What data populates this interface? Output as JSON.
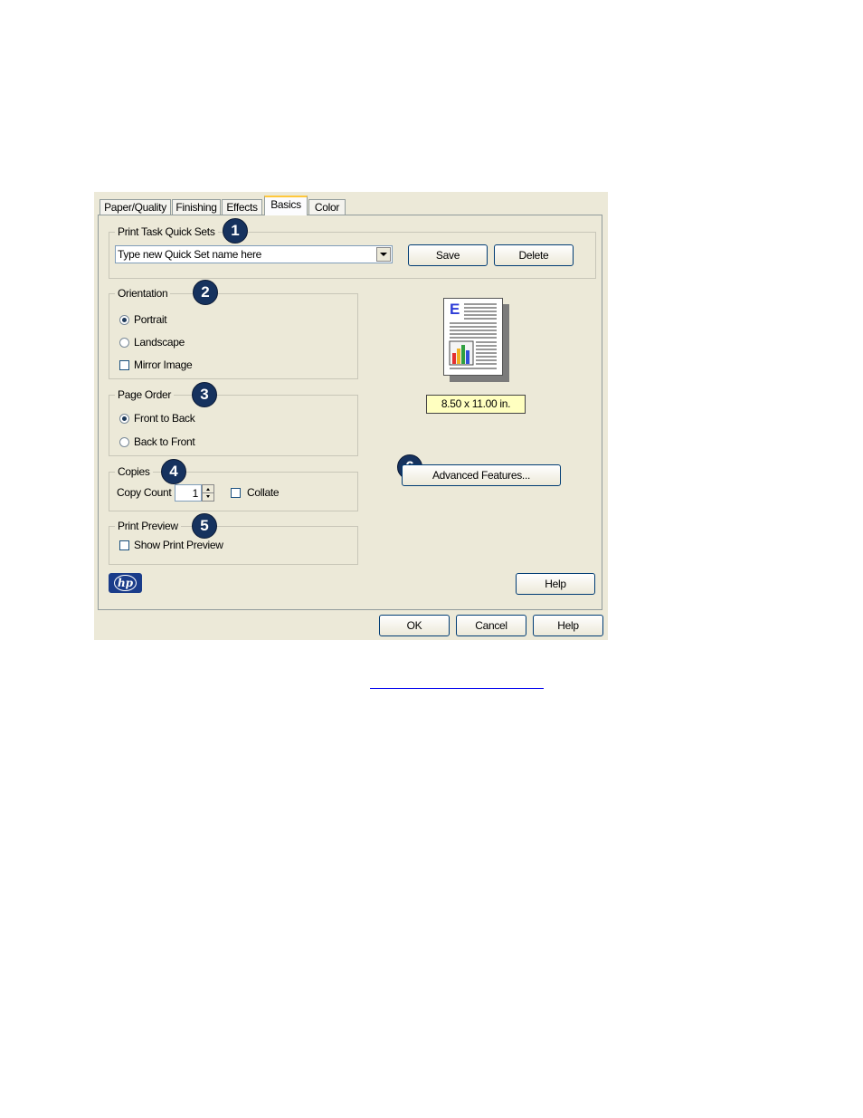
{
  "tabs": [
    "Paper/Quality",
    "Finishing",
    "Effects",
    "Basics",
    "Color"
  ],
  "active_tab": "Basics",
  "quick_sets": {
    "legend": "Print Task Quick Sets",
    "badge": "1",
    "value": "Type new Quick Set name here",
    "save": "Save",
    "delete": "Delete"
  },
  "orientation": {
    "legend": "Orientation",
    "badge": "2",
    "portrait": "Portrait",
    "landscape": "Landscape",
    "mirror": "Mirror Image",
    "selected": "Portrait",
    "mirror_checked": false
  },
  "page_order": {
    "legend": "Page Order",
    "badge": "3",
    "front_to_back": "Front to Back",
    "back_to_front": "Back to Front",
    "selected": "Front to Back"
  },
  "copies": {
    "legend": "Copies",
    "badge": "4",
    "count_label": "Copy Count",
    "count": "1",
    "collate": "Collate",
    "collate_checked": false
  },
  "print_preview": {
    "legend": "Print Preview",
    "badge": "5",
    "show": "Show Print Preview",
    "show_checked": false
  },
  "preview": {
    "paper_size": "8.50 x 11.00 in.",
    "page_letter": "E"
  },
  "advanced": {
    "badge": "6",
    "label": "Advanced Features..."
  },
  "help_inner": "Help",
  "footer": {
    "ok": "OK",
    "cancel": "Cancel",
    "help": "Help"
  },
  "logo_text": "hp",
  "colors": {
    "dialog_bg": "#ece9d8",
    "badge": "#16325e",
    "paper_size_bg": "#ffffc0",
    "link": "#0000ee"
  }
}
